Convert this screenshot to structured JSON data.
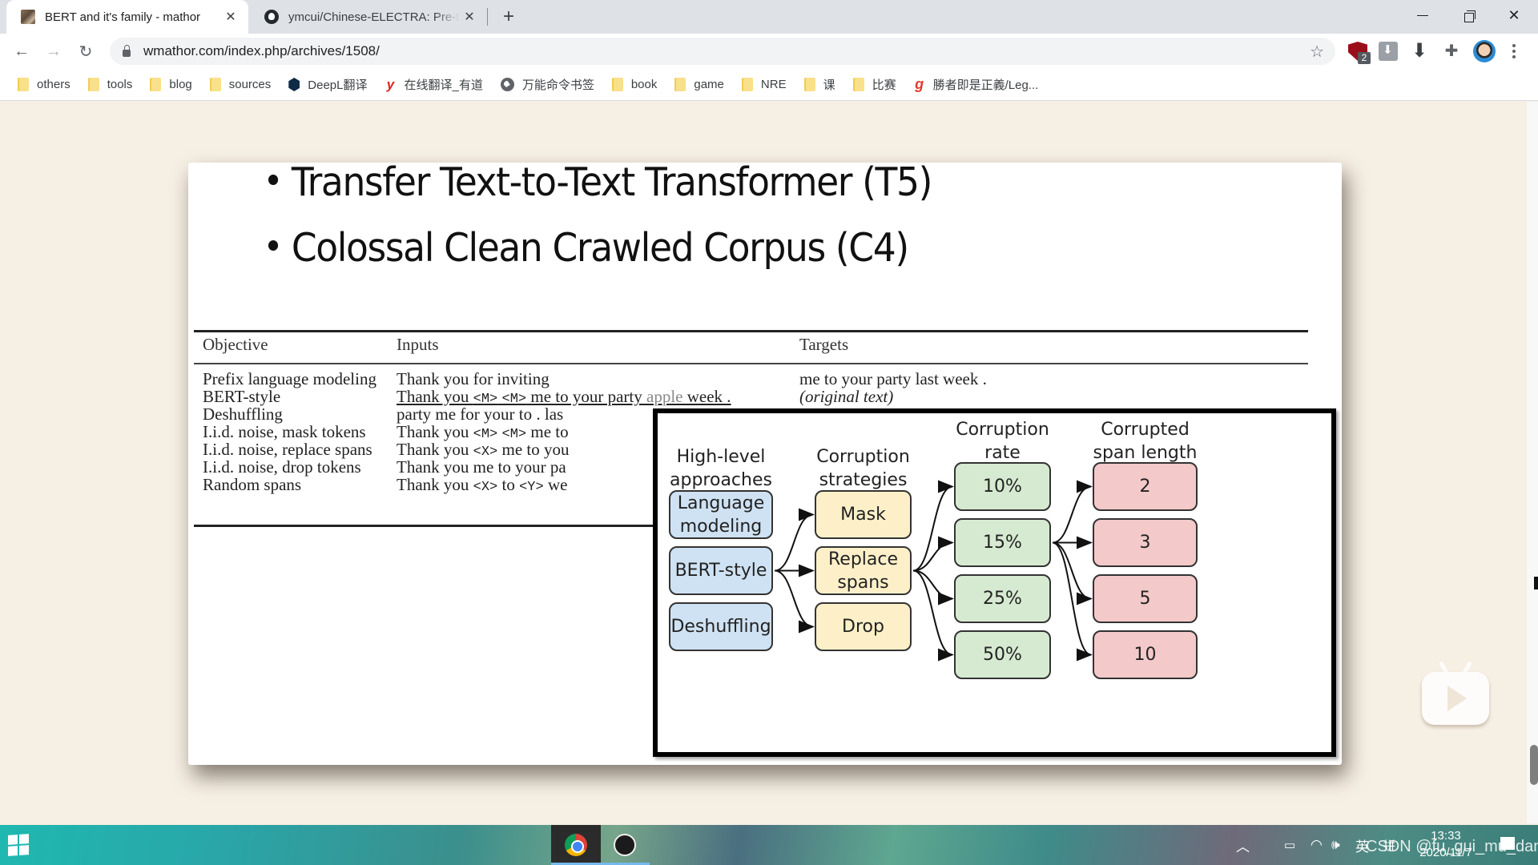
{
  "browser": {
    "tabs": [
      {
        "title": "BERT and it's family - mathor",
        "active": true,
        "favicon": "portrait-icon"
      },
      {
        "title": "ymcui/Chinese-ELECTRA: Pre-t",
        "active": false,
        "favicon": "github-icon"
      }
    ],
    "new_tab_label": "+",
    "close_label": "✕",
    "url": "wmathor.com/index.php/archives/1508/",
    "extension_badge": "2",
    "bookmarks": [
      {
        "label": "others",
        "icon": "folder-icon"
      },
      {
        "label": "tools",
        "icon": "folder-icon"
      },
      {
        "label": "blog",
        "icon": "folder-icon"
      },
      {
        "label": "sources",
        "icon": "folder-icon"
      },
      {
        "label": "DeepL翻译",
        "icon": "deepl-icon"
      },
      {
        "label": "在线翻译_有道",
        "icon": "youdao-icon"
      },
      {
        "label": "万能命令书签",
        "icon": "globe-icon"
      },
      {
        "label": "book",
        "icon": "folder-icon"
      },
      {
        "label": "game",
        "icon": "folder-icon"
      },
      {
        "label": "NRE",
        "icon": "folder-icon"
      },
      {
        "label": "课",
        "icon": "folder-icon"
      },
      {
        "label": "比赛",
        "icon": "folder-icon"
      },
      {
        "label": "勝者即是正義/Leg...",
        "icon": "g-icon"
      }
    ]
  },
  "slide": {
    "bullets": [
      "Transfer Text-to-Text Transformer (T5)",
      "Colossal Clean Crawled Corpus (C4)"
    ],
    "table": {
      "headers": [
        "Objective",
        "Inputs",
        "Targets"
      ],
      "rows": [
        {
          "objective": "Prefix language modeling",
          "input": "Thank you for inviting",
          "target": "me to your party last week ."
        },
        {
          "objective": "BERT-style",
          "input": "Thank you <M> <M> me to your party apple week .",
          "target": "(original text)"
        },
        {
          "objective": "Deshuffling",
          "input": "party me for your to . las",
          "target": ""
        },
        {
          "objective": "I.i.d. noise, mask tokens",
          "input": "Thank you <M> <M> me to",
          "target": ""
        },
        {
          "objective": "I.i.d. noise, replace spans",
          "input": "Thank you <X> me to you",
          "target": ""
        },
        {
          "objective": "I.i.d. noise, drop tokens",
          "input": "Thank you me to your pa",
          "target": ""
        },
        {
          "objective": "Random spans",
          "input": "Thank you <X> to <Y> we",
          "target": ""
        }
      ]
    },
    "diagram": {
      "columns": [
        {
          "header": "High-level\napproaches",
          "nodes": [
            "Language\nmodeling",
            "BERT-style",
            "Deshuffling"
          ],
          "color": "#cfe2f3"
        },
        {
          "header": "Corruption\nstrategies",
          "nodes": [
            "Mask",
            "Replace\nspans",
            "Drop"
          ],
          "color": "#fdf0c9"
        },
        {
          "header": "Corruption\nrate",
          "nodes": [
            "10%",
            "15%",
            "25%",
            "50%"
          ],
          "color": "#d6ead1"
        },
        {
          "header": "Corrupted\nspan length",
          "nodes": [
            "2",
            "3",
            "5",
            "10"
          ],
          "color": "#f4c9c9"
        }
      ],
      "edges": [
        [
          "BERT-style",
          "Mask"
        ],
        [
          "BERT-style",
          "Replace\nspans"
        ],
        [
          "BERT-style",
          "Drop"
        ],
        [
          "Replace\nspans",
          "10%"
        ],
        [
          "Replace\nspans",
          "15%"
        ],
        [
          "Replace\nspans",
          "25%"
        ],
        [
          "Replace\nspans",
          "50%"
        ],
        [
          "15%",
          "2"
        ],
        [
          "15%",
          "3"
        ],
        [
          "15%",
          "5"
        ],
        [
          "15%",
          "10"
        ]
      ]
    }
  },
  "taskbar": {
    "ime_lang": "英",
    "ime_mode": "拼",
    "time": "13:33",
    "date": "2020/11/7",
    "watermark": "CSDN @fu_gui_mu_dan"
  }
}
